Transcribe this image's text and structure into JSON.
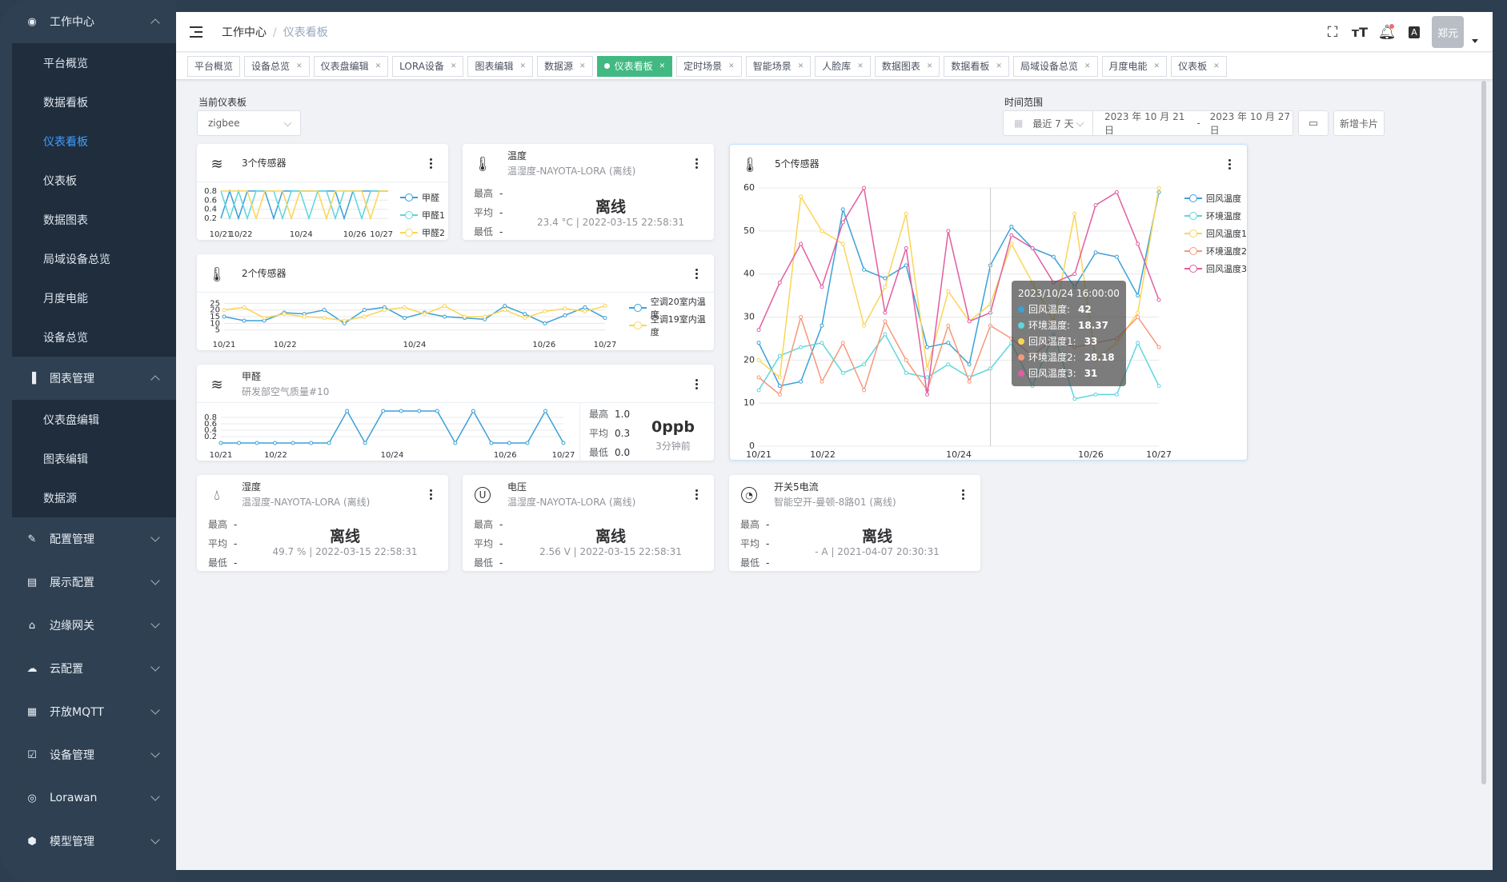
{
  "sidebar": {
    "work_center": "工作中心",
    "work_items": [
      "平台概览",
      "数据看板",
      "仪表看板",
      "仪表板",
      "数据图表",
      "局域设备总览",
      "月度电能",
      "设备总览"
    ],
    "chart_mgmt": "图表管理",
    "chart_items": [
      "仪表盘编辑",
      "图表编辑",
      "数据源"
    ],
    "groups": [
      "配置管理",
      "展示配置",
      "边缘网关",
      "云配置",
      "开放MQTT",
      "设备管理",
      "Lorawan",
      "模型管理"
    ]
  },
  "header": {
    "breadcrumb_root": "工作中心",
    "breadcrumb_sep": "/",
    "breadcrumb_current": "仪表看板",
    "user": "郑元"
  },
  "tabs": [
    "平台概览",
    "设备总览",
    "仪表盘编辑",
    "LORA设备",
    "图表编辑",
    "数据源",
    "仪表看板",
    "定时场景",
    "智能场景",
    "人脸库",
    "数据图表",
    "数据看板",
    "局域设备总览",
    "月度电能",
    "仪表板"
  ],
  "controls": {
    "dashboard_label": "当前仪表板",
    "dashboard_value": "zigbee",
    "range_label": "时间范围",
    "range_preset": "最近 7 天",
    "start_date": "2023 年 10 月 21 日",
    "date_sep": "-",
    "end_date": "2023 年 10 月 27 日",
    "add_card": "新增卡片"
  },
  "cards": {
    "c1": {
      "title": "3个传感器",
      "legend": [
        "甲醛",
        "甲醛1",
        "甲醛2"
      ]
    },
    "c2": {
      "title": "温度",
      "subtitle": "温湿度-NAYOTA-LORA (离线)",
      "status": "离线",
      "meta": "23.4 °C | 2022-03-15 22:58:31"
    },
    "c3": {
      "title": "2个传感器",
      "legend": [
        "空调20室内温度",
        "空调19室内温度"
      ]
    },
    "c4": {
      "title": "甲醛",
      "subtitle": "研发部空气质量#10",
      "value": "0ppb",
      "ago": "3分钟前",
      "max": "1.0",
      "avg": "0.3",
      "min": "0.0"
    },
    "c5": {
      "title": "5个传感器",
      "legend": [
        "回风温度",
        "环境温度",
        "回风温度1",
        "环境温度2",
        "回风温度3"
      ]
    },
    "c6": {
      "title": "湿度",
      "subtitle": "温湿度-NAYOTA-LORA (离线)",
      "status": "离线",
      "meta": "49.7 % | 2022-03-15 22:58:31"
    },
    "c7": {
      "title": "电压",
      "subtitle": "温湿度-NAYOTA-LORA (离线)",
      "status": "离线",
      "meta": "2.56 V | 2022-03-15 22:58:31"
    },
    "c8": {
      "title": "开关5电流",
      "subtitle": "智能空开-曼顿-8路01 (离线)",
      "status": "离线",
      "meta": "- A | 2021-04-07 20:30:31"
    }
  },
  "stat_labels": {
    "max": "最高",
    "avg": "平均",
    "min": "最低",
    "dash": "-"
  },
  "tooltip": {
    "title": "2023/10/24 16:00:00",
    "rows": [
      {
        "name": "回风温度:",
        "value": "42"
      },
      {
        "name": "环境温度:",
        "value": "18.37"
      },
      {
        "name": "回风温度1:",
        "value": "33"
      },
      {
        "name": "环境温度2:",
        "value": "28.18"
      },
      {
        "name": "回风温度3:",
        "value": "31"
      }
    ]
  },
  "colors": {
    "blue": "#3ba1d8",
    "cyan": "#5ed6dc",
    "yellow": "#fbd556",
    "orange": "#f6987a",
    "pink": "#e25da1",
    "green": "#42b983"
  },
  "chart_data": [
    {
      "type": "line",
      "title": "3个传感器",
      "x": [
        "10/21",
        "10/22",
        "10/24",
        "10/26",
        "10/27"
      ],
      "ylim": [
        0.2,
        0.8
      ],
      "yticks": [
        "0.8",
        "0.6",
        "0.4",
        "0.2"
      ],
      "series": [
        {
          "name": "甲醛",
          "values": [
            0.2,
            0.8,
            0.2,
            0.8,
            0.8,
            0.8,
            0.2,
            0.8,
            0.8,
            0.8,
            0.8,
            0.8,
            0.8,
            0.8,
            0.2,
            0.8,
            0.8,
            0.8,
            0.8,
            0.8
          ]
        },
        {
          "name": "甲醛1",
          "values": [
            0.8,
            0.2,
            0.8,
            0.2,
            0.8,
            0.8,
            0.8,
            0.2,
            0.8,
            0.8,
            0.2,
            0.8,
            0.8,
            0.2,
            0.8,
            0.8,
            0.2,
            0.8,
            0.8,
            0.8
          ]
        },
        {
          "name": "甲醛2",
          "values": [
            0.8,
            0.8,
            0.8,
            0.8,
            0.2,
            0.8,
            0.8,
            0.8,
            0.2,
            0.8,
            0.8,
            0.8,
            0.2,
            0.8,
            0.8,
            0.8,
            0.8,
            0.2,
            0.8,
            0.8
          ]
        }
      ]
    },
    {
      "type": "line",
      "title": "2个传感器",
      "x": [
        "10/21",
        "10/22",
        "10/24",
        "10/26",
        "10/27"
      ],
      "ylim": [
        5,
        25
      ],
      "yticks": [
        "25",
        "20",
        "15",
        "10",
        "5"
      ],
      "series": [
        {
          "name": "空调20室内温度",
          "values": [
            15,
            12,
            12,
            18,
            17,
            20,
            10,
            20,
            22,
            14,
            18,
            15,
            14,
            13,
            23,
            17,
            10,
            16,
            22,
            14
          ]
        },
        {
          "name": "空调19室内温度",
          "values": [
            20,
            22,
            14,
            17,
            15,
            14,
            12,
            15,
            20,
            22,
            17,
            23,
            15,
            15,
            20,
            14,
            19,
            21,
            19,
            23
          ]
        }
      ]
    },
    {
      "type": "line",
      "title": "甲醛",
      "x": [
        "10/21",
        "10/22",
        "10/24",
        "10/26",
        "10/27"
      ],
      "ylim": [
        0.2,
        0.8
      ],
      "yticks": [
        "0.8",
        "0.6",
        "0.4",
        "0.2"
      ],
      "series": [
        {
          "name": "甲醛",
          "values": [
            0,
            0,
            0,
            0,
            0,
            0,
            0,
            1,
            0,
            1,
            1,
            1,
            1,
            0,
            1,
            0,
            0,
            0,
            1,
            0
          ]
        }
      ]
    },
    {
      "type": "line",
      "title": "5个传感器",
      "x": [
        "10/21",
        "10/22",
        "10/24",
        "10/26",
        "10/27"
      ],
      "ylim": [
        0,
        60
      ],
      "yticks": [
        "60",
        "50",
        "40",
        "30",
        "20",
        "10",
        "0"
      ],
      "series": [
        {
          "name": "回风温度",
          "values": [
            24,
            14,
            15,
            28,
            55,
            41,
            39,
            42,
            23,
            24,
            19,
            42,
            51,
            46,
            44,
            37,
            45,
            44,
            35,
            59
          ]
        },
        {
          "name": "环境温度",
          "values": [
            13,
            21,
            23,
            24,
            17,
            19,
            26,
            17,
            16,
            19,
            16,
            18,
            24,
            14,
            26,
            11,
            12,
            12,
            24,
            14
          ]
        },
        {
          "name": "回风温度1",
          "values": [
            20,
            16,
            58,
            50,
            47,
            28,
            37,
            54,
            18,
            36,
            29,
            33,
            47,
            38,
            29,
            54,
            20,
            24,
            31,
            60
          ]
        },
        {
          "name": "环境温度2",
          "values": [
            16,
            12,
            30,
            15,
            24,
            13,
            29,
            20,
            13,
            28,
            15,
            28,
            25,
            21,
            25,
            23,
            24,
            25,
            30,
            23
          ]
        },
        {
          "name": "回风温度3",
          "values": [
            27,
            38,
            47,
            37,
            52,
            60,
            31,
            46,
            12,
            50,
            29,
            31,
            49,
            46,
            38,
            40,
            56,
            59,
            47,
            34
          ]
        }
      ]
    }
  ]
}
